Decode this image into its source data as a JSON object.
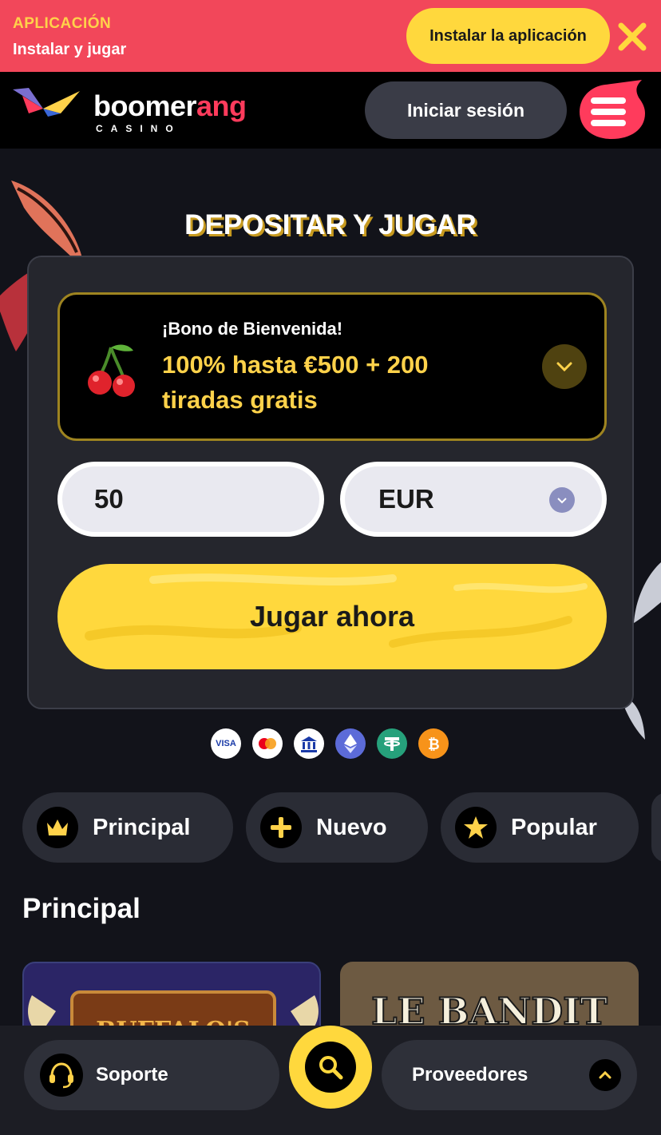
{
  "app_banner": {
    "kicker": "APLICACIÓN",
    "subtitle": "Instalar y jugar",
    "install_label": "Instalar la aplicación",
    "close_icon": "close-icon"
  },
  "header": {
    "logo_text_a": "boomer",
    "logo_text_b": "ang",
    "logo_sub": "CASINO",
    "login_label": "Iniciar sesión",
    "menu_icon": "hamburger-menu-icon"
  },
  "hero": {
    "title": "DEPOSITAR Y JUGAR"
  },
  "deposit_card": {
    "bonus_kicker": "¡Bono de Bienvenida!",
    "bonus_text": "100% hasta €500 + 200 tiradas gratis",
    "bonus_icon": "cherries-icon",
    "amount_value": "50",
    "currency_value": "EUR",
    "play_label": "Jugar ahora"
  },
  "payments": [
    {
      "name": "VISA",
      "icon": "visa-icon"
    },
    {
      "name": "Mastercard",
      "icon": "mastercard-icon"
    },
    {
      "name": "Bank",
      "icon": "bank-icon"
    },
    {
      "name": "Ethereum",
      "icon": "ethereum-icon"
    },
    {
      "name": "Tether",
      "icon": "tether-icon"
    },
    {
      "name": "Bitcoin",
      "icon": "bitcoin-icon"
    }
  ],
  "payment_visa_text": "VISA",
  "categories": [
    {
      "label": "Principal",
      "icon": "crown-icon"
    },
    {
      "label": "Nuevo",
      "icon": "plus-icon"
    },
    {
      "label": "Popular",
      "icon": "star-icon"
    }
  ],
  "section": {
    "title": "Principal"
  },
  "games": [
    {
      "title": "BUFFALO'S"
    },
    {
      "title": "LE BANDIT"
    }
  ],
  "bottom_bar": {
    "support_label": "Soporte",
    "providers_label": "Proveedores",
    "search_icon": "search-icon"
  },
  "colors": {
    "accent_yellow": "#ffd83d",
    "banner_red": "#f2475a",
    "brand_pink": "#ff3b5c",
    "background": "#12131a"
  }
}
